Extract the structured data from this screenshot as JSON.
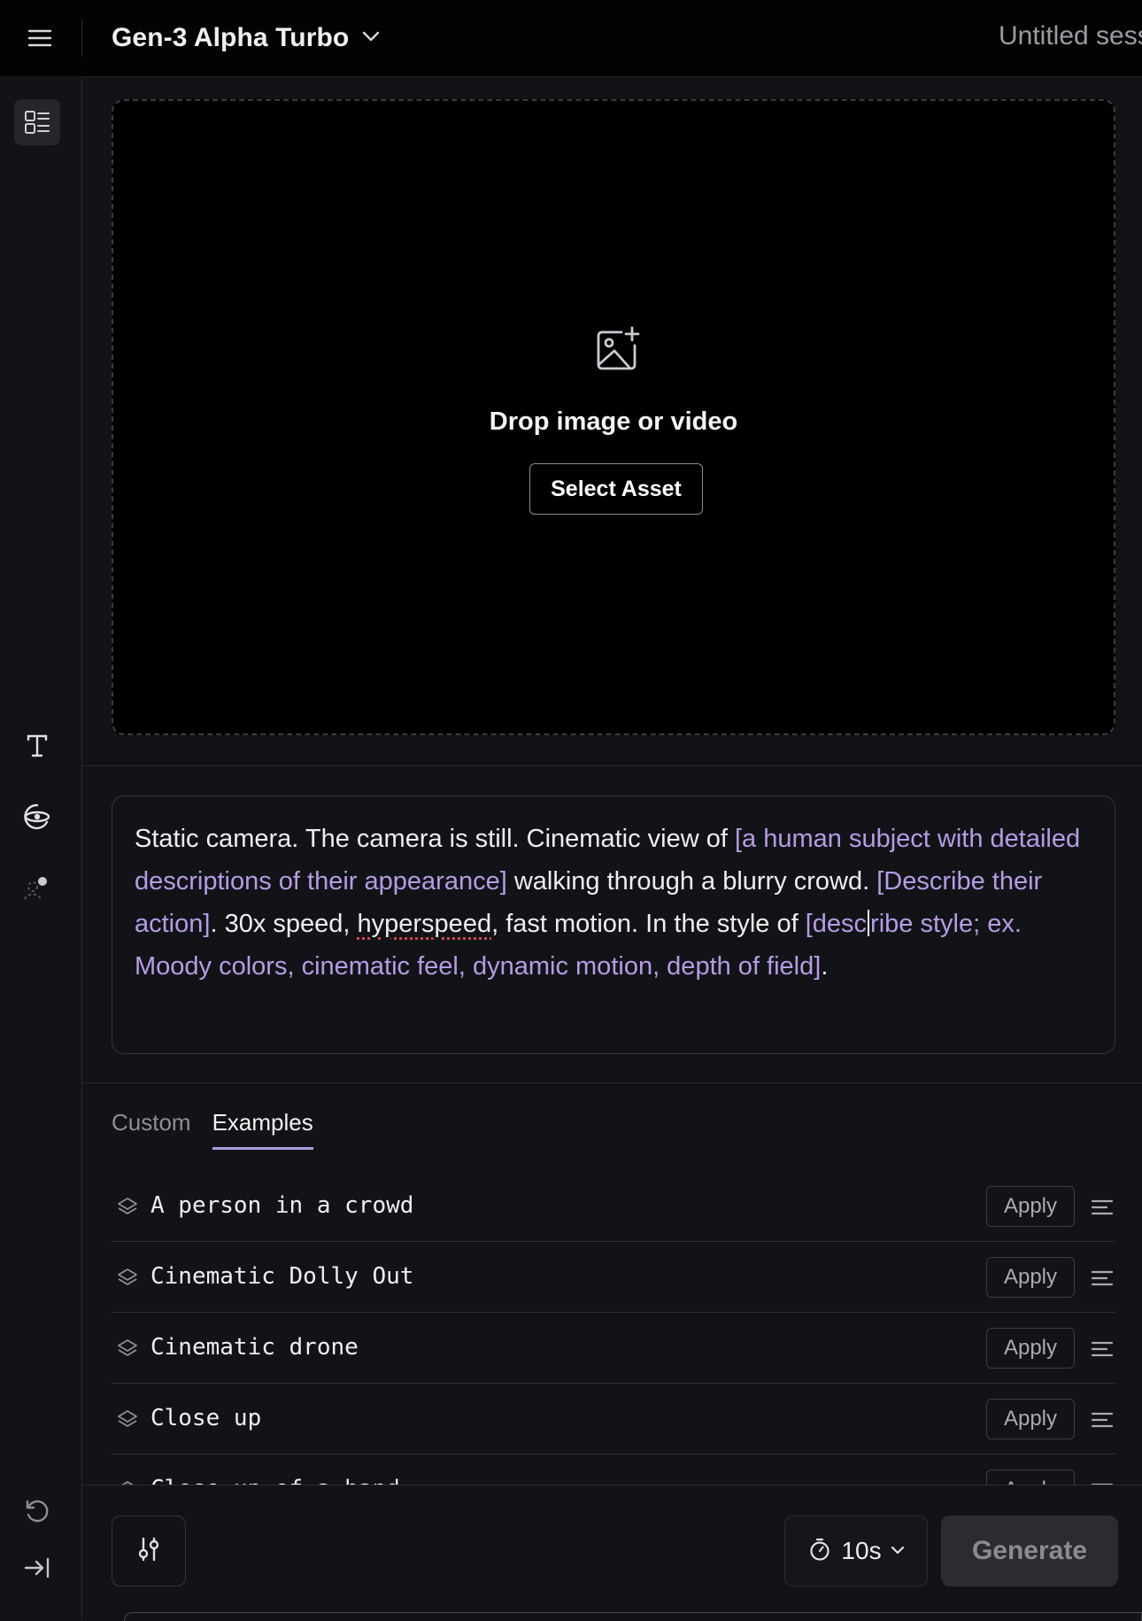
{
  "header": {
    "model_name": "Gen-3 Alpha Turbo",
    "session_title": "Untitled session"
  },
  "icons": {
    "menu": "hamburger-menu-icon",
    "model_dropdown": "chevron-down-icon",
    "sidebar_top": "layout-list-icon",
    "text": "text-tool-icon",
    "camera": "camera-control-icon",
    "character": "character-icon",
    "undo": "history-icon",
    "collapse": "collapse-sidebar-icon",
    "upload": "image-plus-icon",
    "example": "layers-icon",
    "detail": "text-align-icon",
    "settings": "settings-sliders-icon",
    "timer": "timer-icon"
  },
  "upload": {
    "drop_text": "Drop image or video",
    "select_label": "Select Asset"
  },
  "prompt": {
    "seg1": "Static camera. The camera is still. Cinematic view of ",
    "ph1": "[a human subject with detailed descriptions of their appearance]",
    "seg2": " walking through a blurry crowd. ",
    "ph2": "[Describe their action]",
    "seg3": ". 30x speed, ",
    "seg3_misspelled": "hyperspeed",
    "seg4": ", fast motion. In the style of ",
    "ph3_a": "[desc",
    "ph3_b": "ribe style; ex. Moody colors, cinematic feel, dynamic motion, depth of field]",
    "seg5": "."
  },
  "tabs": [
    {
      "label": "Custom",
      "active": false
    },
    {
      "label": "Examples",
      "active": true
    }
  ],
  "examples": [
    {
      "label": "A person in a crowd",
      "apply": "Apply"
    },
    {
      "label": "Cinematic Dolly Out",
      "apply": "Apply"
    },
    {
      "label": "Cinematic drone",
      "apply": "Apply"
    },
    {
      "label": "Close up",
      "apply": "Apply"
    },
    {
      "label": "Close up of a hand",
      "apply": "Apply"
    }
  ],
  "footer": {
    "duration": "10s",
    "generate": "Generate"
  },
  "colors": {
    "placeholder_text": "#b69be6",
    "tab_underline": "#a89fe0",
    "background": "#121316"
  }
}
